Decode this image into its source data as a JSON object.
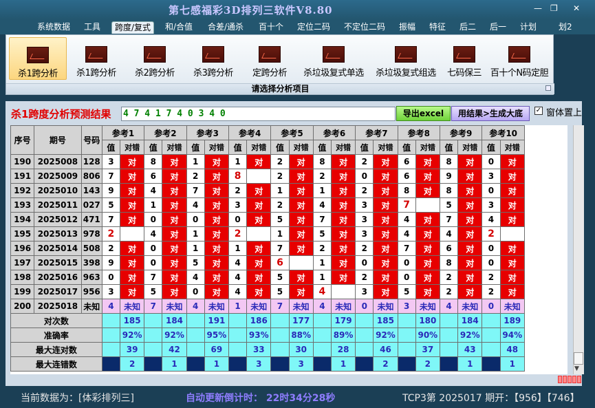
{
  "window": {
    "title": "第七感福彩3D排列三软件V8.80",
    "minimize": "—",
    "restore": "❐",
    "close": "✕"
  },
  "menu": [
    "系统数据",
    "工具",
    "跨度/复式",
    "和/合值",
    "合差/通杀",
    "百十个",
    "定位二码",
    "不定位二码",
    "振幅",
    "特征",
    "后二",
    "后一",
    "计划",
    "划2"
  ],
  "menu_active_index": 2,
  "ribbon": {
    "buttons": [
      "杀1跨分析",
      "杀1跨分析",
      "杀2跨分析",
      "杀3跨分析",
      "定跨分析",
      "杀垃圾复式单选",
      "杀垃圾复式组选",
      "七码保三",
      "百十个N码定胆"
    ],
    "active_index": 0,
    "group_label": "请选择分析项目"
  },
  "result": {
    "label": "杀1跨度分析预测结果",
    "value": "4 7 4 1 7 4 0 3 4 0",
    "export_button": "导出excel",
    "generate_button": "用结果>生成大底",
    "topmost_label": "窗体置上",
    "topmost_checked": true
  },
  "table": {
    "col_seq": "序号",
    "col_period": "期号",
    "col_number": "号码",
    "refs": [
      "参考1",
      "参考2",
      "参考3",
      "参考4",
      "参考5",
      "参考6",
      "参考7",
      "参考8",
      "参考9",
      "参考10"
    ],
    "sub_value": "值",
    "sub_result": "对错",
    "correct_text": "对",
    "unknown_text": "未知",
    "rows": [
      {
        "seq": "190",
        "period": "2025008",
        "number": "128",
        "vals": [
          "3",
          "8",
          "1",
          "1",
          "2",
          "8",
          "2",
          "6",
          "8",
          "0"
        ],
        "ok": [
          1,
          1,
          1,
          1,
          1,
          1,
          1,
          1,
          1,
          1
        ]
      },
      {
        "seq": "191",
        "period": "2025009",
        "number": "806",
        "vals": [
          "7",
          "6",
          "2",
          "8",
          "2",
          "2",
          "0",
          "6",
          "9",
          "3"
        ],
        "ok": [
          1,
          1,
          1,
          0,
          1,
          1,
          1,
          1,
          1,
          1
        ]
      },
      {
        "seq": "192",
        "period": "2025010",
        "number": "143",
        "vals": [
          "9",
          "4",
          "7",
          "2",
          "1",
          "1",
          "2",
          "8",
          "8",
          "0"
        ],
        "ok": [
          1,
          1,
          1,
          1,
          1,
          1,
          1,
          1,
          1,
          1
        ]
      },
      {
        "seq": "193",
        "period": "2025011",
        "number": "027",
        "vals": [
          "5",
          "1",
          "4",
          "3",
          "2",
          "4",
          "3",
          "7",
          "5",
          "3"
        ],
        "ok": [
          1,
          1,
          1,
          1,
          1,
          1,
          1,
          0,
          1,
          1
        ]
      },
      {
        "seq": "194",
        "period": "2025012",
        "number": "471",
        "vals": [
          "7",
          "0",
          "0",
          "0",
          "5",
          "7",
          "3",
          "4",
          "7",
          "4"
        ],
        "ok": [
          1,
          1,
          1,
          1,
          1,
          1,
          1,
          1,
          1,
          1
        ]
      },
      {
        "seq": "195",
        "period": "2025013",
        "number": "978",
        "vals": [
          "2",
          "4",
          "1",
          "2",
          "1",
          "5",
          "3",
          "4",
          "4",
          "2"
        ],
        "ok": [
          0,
          1,
          1,
          0,
          1,
          1,
          1,
          1,
          1,
          0
        ]
      },
      {
        "seq": "196",
        "period": "2025014",
        "number": "508",
        "vals": [
          "2",
          "0",
          "1",
          "1",
          "7",
          "2",
          "2",
          "7",
          "6",
          "0"
        ],
        "ok": [
          1,
          1,
          1,
          1,
          1,
          1,
          1,
          1,
          1,
          1
        ]
      },
      {
        "seq": "197",
        "period": "2025015",
        "number": "398",
        "vals": [
          "9",
          "0",
          "5",
          "4",
          "6",
          "1",
          "0",
          "0",
          "8",
          "0"
        ],
        "ok": [
          1,
          1,
          1,
          1,
          0,
          1,
          1,
          1,
          1,
          1
        ]
      },
      {
        "seq": "198",
        "period": "2025016",
        "number": "963",
        "vals": [
          "0",
          "7",
          "4",
          "4",
          "5",
          "1",
          "2",
          "0",
          "2",
          "2"
        ],
        "ok": [
          1,
          1,
          1,
          1,
          1,
          1,
          1,
          1,
          1,
          1
        ]
      },
      {
        "seq": "199",
        "period": "2025017",
        "number": "956",
        "vals": [
          "3",
          "5",
          "0",
          "4",
          "5",
          "4",
          "3",
          "5",
          "2",
          "2"
        ],
        "ok": [
          1,
          1,
          1,
          1,
          1,
          0,
          1,
          1,
          1,
          1
        ]
      }
    ],
    "pending": {
      "seq": "200",
      "period": "2025018",
      "number": "未知",
      "vals": [
        "4",
        "7",
        "4",
        "1",
        "7",
        "4",
        "0",
        "3",
        "4",
        "0"
      ]
    },
    "summary_labels": [
      "对次数",
      "准确率",
      "最大连对数",
      "最大连错数"
    ],
    "hit_counts": [
      "185",
      "184",
      "191",
      "186",
      "177",
      "179",
      "185",
      "180",
      "184",
      "189"
    ],
    "accuracy": [
      "92%",
      "92%",
      "95%",
      "93%",
      "88%",
      "89%",
      "92%",
      "90%",
      "92%",
      "94%"
    ],
    "max_streak_hit": [
      "39",
      "42",
      "69",
      "33",
      "30",
      "28",
      "46",
      "37",
      "43",
      "48"
    ],
    "max_streak_miss": [
      "2",
      "1",
      "1",
      "3",
      "3",
      "1",
      "2",
      "2",
      "1",
      "1"
    ]
  },
  "status": {
    "current_data": "当前数据为：[体彩排列三]",
    "countdown": "自动更新倒计时：  22时34分28秒",
    "draw_info": "TCP3第 2025017 期开：【956】【746】"
  }
}
